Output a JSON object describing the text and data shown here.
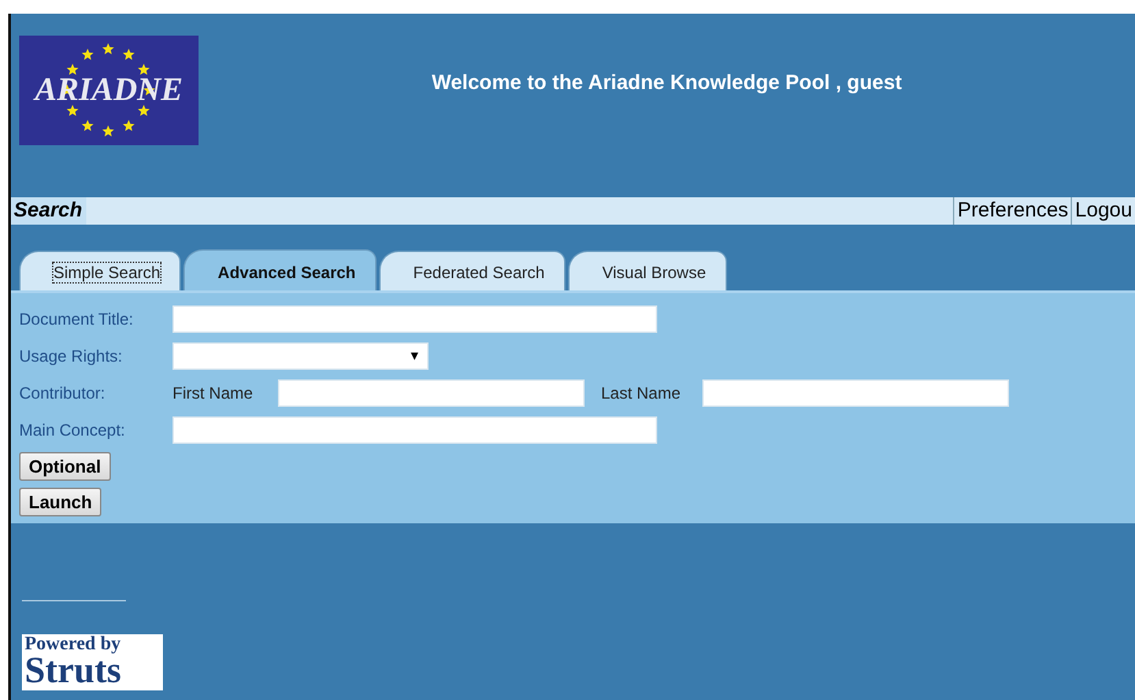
{
  "logo": {
    "text": "ARIADNE"
  },
  "header": {
    "welcome": "Welcome to the Ariadne Knowledge Pool , guest"
  },
  "menu_bar": {
    "title": "Search",
    "links": [
      "Preferences",
      "Logou"
    ]
  },
  "tabs": [
    {
      "label": "Simple Search",
      "selected": false,
      "focused": true
    },
    {
      "label": "Advanced Search",
      "selected": true,
      "focused": false
    },
    {
      "label": "Federated Search",
      "selected": false,
      "focused": false
    },
    {
      "label": "Visual Browse",
      "selected": false,
      "focused": false
    }
  ],
  "form": [
    {
      "kind": "text",
      "label": "Document Title:"
    },
    {
      "kind": "select",
      "label": "Usage Rights:",
      "arrow": "▾"
    },
    {
      "kind": "name-pair",
      "label": "Contributor:",
      "first": "First Name",
      "last": "Last Name"
    },
    {
      "kind": "text",
      "label": "Main Concept:"
    }
  ],
  "buttons": [
    "Optional",
    "Launch"
  ],
  "footer": {
    "powered": "Powered by",
    "brand": "Struts"
  }
}
